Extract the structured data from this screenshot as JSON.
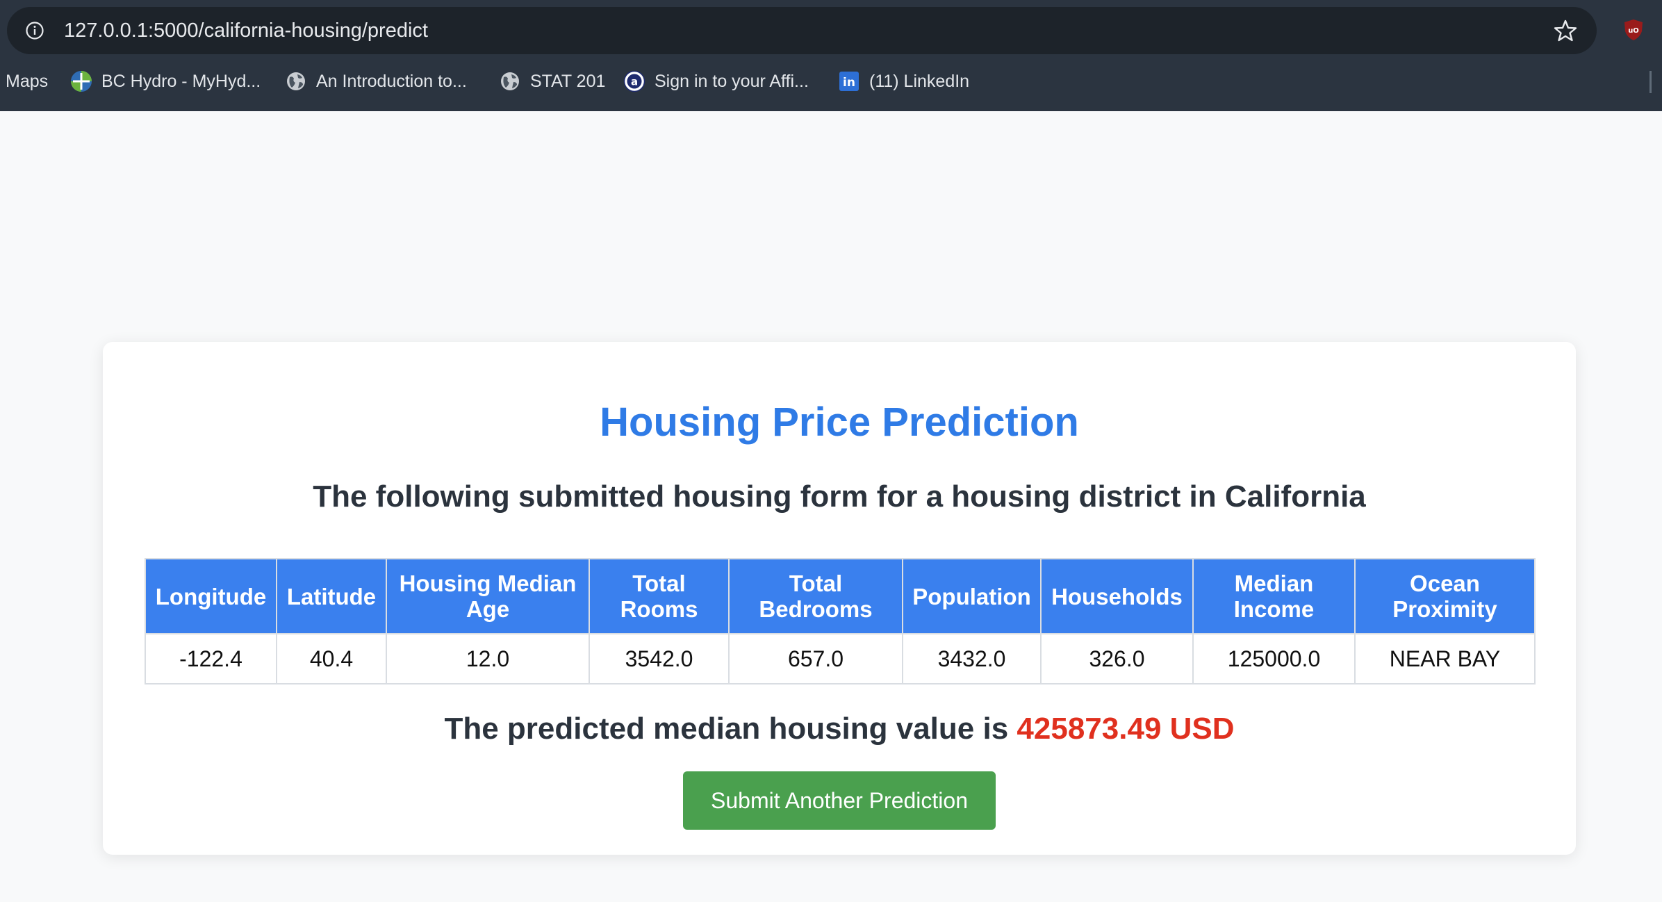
{
  "browser": {
    "url": "127.0.0.1:5000/california-housing/predict",
    "bookmarks": [
      {
        "label": "Maps",
        "icon": "maps-icon"
      },
      {
        "label": "BC Hydro - MyHyd...",
        "icon": "bc-hydro-icon"
      },
      {
        "label": "An Introduction to...",
        "icon": "globe-icon"
      },
      {
        "label": "STAT 201",
        "icon": "globe-icon"
      },
      {
        "label": "Sign in to your Affi...",
        "icon": "affinity-icon"
      },
      {
        "label": "(11) LinkedIn",
        "icon": "linkedin-icon"
      }
    ],
    "extension_icon": "ublock-icon",
    "extension_label": "uO"
  },
  "page": {
    "title": "Housing Price Prediction",
    "subtitle": "The following submitted housing form for a housing district in California",
    "table": {
      "headers": [
        "Longitude",
        "Latitude",
        "Housing Median Age",
        "Total Rooms",
        "Total Bedrooms",
        "Population",
        "Households",
        "Median Income",
        "Ocean Proximity"
      ],
      "rows": [
        [
          "-122.4",
          "40.4",
          "12.0",
          "3542.0",
          "657.0",
          "3432.0",
          "326.0",
          "125000.0",
          "NEAR BAY"
        ]
      ]
    },
    "result": {
      "prefix": "The predicted median housing value is",
      "value": "425873.49 USD"
    },
    "submit_button": "Submit Another Prediction",
    "colors": {
      "title": "#2f7be6",
      "header_bg": "#3a80ee",
      "result_value": "#e0301e",
      "button_bg": "#4aa04e"
    }
  }
}
